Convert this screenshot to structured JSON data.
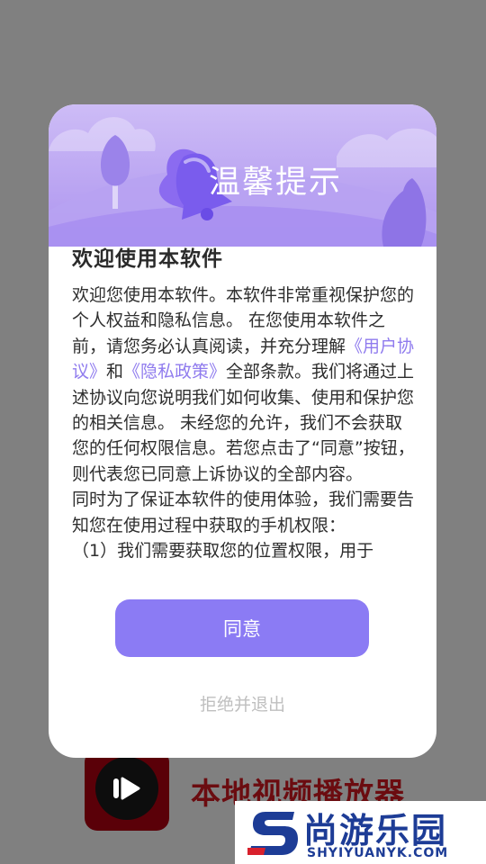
{
  "background_app": {
    "app_name": "本地视频播放器",
    "app_icon": "play-icon"
  },
  "dialog": {
    "header_title": "温馨提示",
    "header_icon": "bell-icon",
    "heading": "欢迎使用本软件",
    "body": {
      "p1_a": "欢迎您使用本软件。本软件非常重视保护您的个人权益和隐私信息。 在您使用本软件之前，请您务必认真阅读，并充分理解",
      "user_agreement_link": "《用户协议》",
      "and": "和",
      "privacy_policy_link": "《隐私政策》",
      "p1_b": "全部条款。我们将通过上述协议向您说明我们如何收集、使用和保护您的相关信息。 未经您的允许，我们不会获取您的任何权限信息。若您点击了“同意”按钮，则代表您已同意上诉协议的全部内容。",
      "p2": " 同时为了保证本软件的使用体验，我们需要告知您在使用过程中获取的手机权限：",
      "p3": "（1）我们需要获取您的位置权限，用于"
    },
    "agree_label": "同意",
    "reject_label": "拒绝并退出",
    "accent_color": "#8b7bf4"
  },
  "watermark": {
    "name": "尚游乐园",
    "url": "SHYIYUANYK.COM"
  }
}
